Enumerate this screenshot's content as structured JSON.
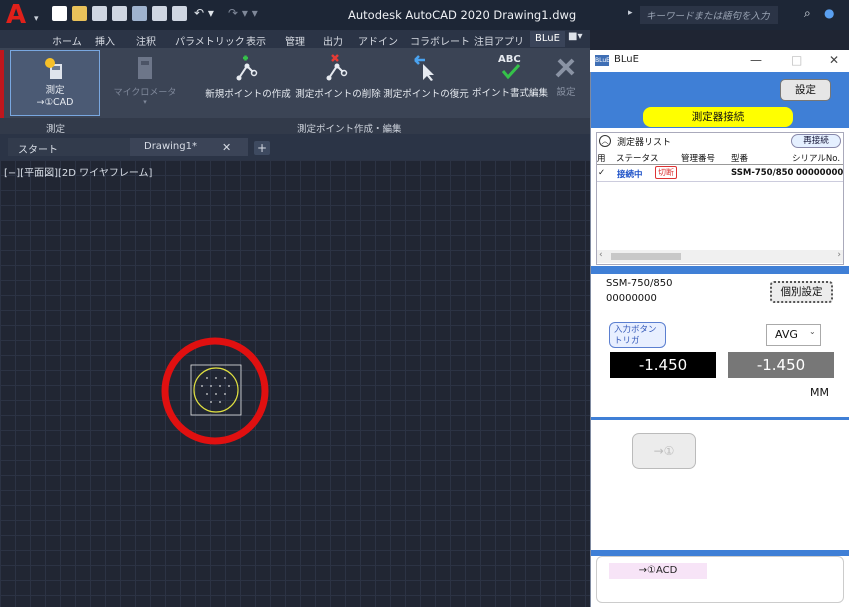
{
  "app": {
    "title": "Autodesk AutoCAD 2020   Drawing1.dwg",
    "search_placeholder": "キーワードまたは語句を入力"
  },
  "ribbon_tabs": [
    "ホーム",
    "挿入",
    "注釈",
    "パラメトリック",
    "表示",
    "管理",
    "出力",
    "アドイン",
    "コラボレート",
    "注目アプリ",
    "BLuE"
  ],
  "ribbon_active_tab": "BLuE",
  "ribbon": {
    "measure_label_1": "測定",
    "measure_label_2": "→①CAD",
    "micrometer_label": "マイクロメータ",
    "new_point": "新規ポイントの作成",
    "delete_point": "測定ポイントの削除",
    "restore_point": "測定ポイントの復元",
    "format_edit": "ポイント書式編集",
    "settings": "設定",
    "panel_measure": "測定",
    "panel_points": "測定ポイント作成・編集"
  },
  "file_tabs": {
    "start": "スタート",
    "drawing": "Drawing1*"
  },
  "viewport_label": "[−][平面図][2D ワイヤフレーム]",
  "blue": {
    "window_title": "BLuE",
    "settings_button": "設定",
    "connect_button": "測定器接続",
    "list_title": "測定器リスト",
    "reconnect_button": "再接続",
    "columns": [
      "用",
      "ステータス",
      "管理番号",
      "型番",
      "シリアルNo."
    ],
    "row": {
      "status": "接続中",
      "disconnect": "切断",
      "model": "SSM-750/850",
      "serial": "00000000"
    },
    "device_model": "SSM-750/850",
    "device_serial": "00000000",
    "individual_settings": "個別設定",
    "trigger_button_1": "入力ボタン",
    "trigger_button_2": "トリガ",
    "mode_select": "AVG",
    "value_current": "-1.450",
    "value_avg": "-1.450",
    "unit": "MM",
    "send_button": "→①",
    "bottom_button": "→①ACD"
  },
  "colors": {
    "accent_blue": "#3f7fd6",
    "connect_yellow": "#ffff00",
    "highlight_red": "#e01010",
    "drawing_circle": "#e0e040"
  }
}
